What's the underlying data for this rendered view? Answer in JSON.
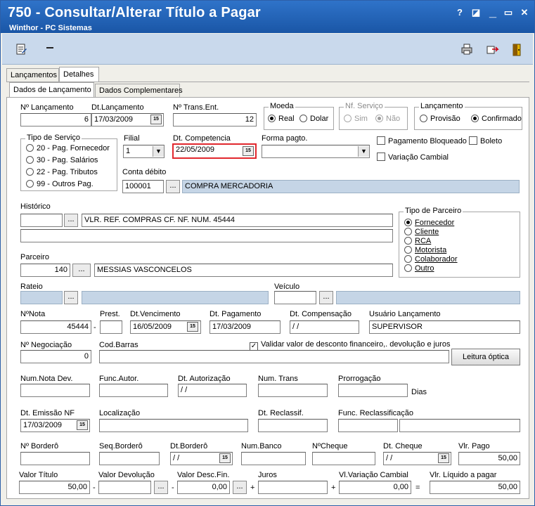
{
  "window": {
    "title": "750 - Consultar/Alterar Título a Pagar",
    "subtitle": "Winthor - PC Sistemas",
    "buttons": [
      "?",
      "◪",
      "▭",
      "✕"
    ]
  },
  "main_tabs": [
    "Lançamentos",
    "Detalhes"
  ],
  "sub_tabs": [
    "Dados de Lançamento",
    "Dados Complementares"
  ],
  "form": {
    "n_lancamento": {
      "label": "Nº Lançamento",
      "value": "6"
    },
    "dt_lancamento": {
      "label": "Dt.Lançamento",
      "value": "17/03/2009"
    },
    "n_trans_ent": {
      "label": "Nº Trans.Ent.",
      "value": "12"
    },
    "moeda": {
      "title": "Moeda",
      "options": [
        "Real",
        "Dolar"
      ],
      "selected": "Real"
    },
    "nf_servico": {
      "title": "Nf. Serviço",
      "options": [
        "Sim",
        "Não"
      ],
      "selected": "Não"
    },
    "lancamento": {
      "title": "Lançamento",
      "options": [
        "Provisão",
        "Confirmado"
      ],
      "selected": "Confirmado"
    },
    "tipo_servico": {
      "title": "Tipo de Serviço",
      "options": [
        "20 - Pag. Fornecedor",
        "30 - Pag. Salários",
        "22 - Pag. Tributos",
        "99 - Outros Pag."
      ]
    },
    "filial": {
      "label": "Filial",
      "value": "1"
    },
    "dt_competencia": {
      "label": "Dt. Competencia",
      "value": "22/05/2009"
    },
    "forma_pagto": {
      "label": "Forma pagto.",
      "value": ""
    },
    "pagamento_bloqueado": {
      "label": "Pagamento Bloqueado",
      "checked": false
    },
    "boleto": {
      "label": "Boleto",
      "checked": false
    },
    "variacao_cambial": {
      "label": "Variação Cambial",
      "checked": false
    },
    "conta_debito": {
      "label": "Conta débito",
      "code": "100001",
      "desc": "COMPRA MERCADORIA"
    },
    "historico": {
      "label": "Histórico",
      "code": "",
      "text": "VLR. REF. COMPRAS CF. NF. NUM. 45444",
      "text2": ""
    },
    "tipo_parceiro": {
      "title": "Tipo de Parceiro",
      "options": [
        "Fornecedor",
        "Cliente",
        "RCA",
        "Motorista",
        "Colaborador",
        "Outro"
      ],
      "selected": "Fornecedor"
    },
    "parceiro": {
      "label": "Parceiro",
      "code": "140",
      "name": "MESSIAS VASCONCELOS"
    },
    "rateio": {
      "label": "Rateio",
      "value": ""
    },
    "veiculo": {
      "label": "Veículo",
      "value": ""
    },
    "n_nota": {
      "label": "NºNota",
      "value": "45444"
    },
    "prest": {
      "label": "Prest.",
      "value": ""
    },
    "dt_vencimento": {
      "label": "Dt.Vencimento",
      "value": "16/05/2009"
    },
    "dt_pagamento": {
      "label": "Dt. Pagamento",
      "value": "17/03/2009"
    },
    "dt_compensacao": {
      "label": "Dt. Compensação",
      "value": " / /"
    },
    "usuario_lancamento": {
      "label": "Usuário Lançamento",
      "value": "SUPERVISOR"
    },
    "n_negociacao": {
      "label": "Nº Negociação",
      "value": "0"
    },
    "cod_barras": {
      "label": "Cod.Barras",
      "value": ""
    },
    "validar_desconto": {
      "label": "Validar valor de desconto financeiro,. devolução e juros",
      "checked": true
    },
    "leitura_optica": {
      "label": "Leitura óptica"
    },
    "num_nota_dev": {
      "label": "Num.Nota Dev.",
      "value": ""
    },
    "func_autor": {
      "label": "Func.Autor.",
      "value": ""
    },
    "dt_autorizacao": {
      "label": "Dt. Autorização",
      "value": " / /"
    },
    "num_trans": {
      "label": "Num. Trans",
      "value": ""
    },
    "prorrogacao": {
      "label": "Prorrogação",
      "value": "",
      "unit": "Dias"
    },
    "dt_emissao_nf": {
      "label": "Dt. Emissão NF",
      "value": "17/03/2009"
    },
    "localizacao": {
      "label": "Localização",
      "value": ""
    },
    "dt_reclassif": {
      "label": "Dt. Reclassif.",
      "value": ""
    },
    "func_reclassificacao": {
      "label": "Func. Reclassificação",
      "value": ""
    },
    "n_bordero": {
      "label": "Nº Borderô",
      "value": ""
    },
    "seq_bordero": {
      "label": "Seq.Borderô",
      "value": ""
    },
    "dt_bordero": {
      "label": "Dt.Borderô",
      "value": " / /"
    },
    "num_banco": {
      "label": "Num.Banco",
      "value": ""
    },
    "n_cheque": {
      "label": "NºCheque",
      "value": ""
    },
    "dt_cheque": {
      "label": "Dt. Cheque",
      "value": " / /"
    },
    "vlr_pago": {
      "label": "Vlr. Pago",
      "value": "50,00"
    },
    "valor_titulo": {
      "label": "Valor Título",
      "value": "50,00"
    },
    "valor_devolucao": {
      "label": "Valor Devolução",
      "value": ""
    },
    "valor_desc_fin": {
      "label": "Valor Desc.Fin.",
      "value": "0,00"
    },
    "juros": {
      "label": "Juros",
      "value": ""
    },
    "vl_variacao_cambial": {
      "label": "Vl.Variação Cambial",
      "value": "0,00"
    },
    "vlr_liquido": {
      "label": "Vlr. Líquido a pagar",
      "value": "50,00"
    }
  },
  "symbols": {
    "minus": "-",
    "plus": "+",
    "equals": "=",
    "ellipsis": "...",
    "cal": "15"
  }
}
